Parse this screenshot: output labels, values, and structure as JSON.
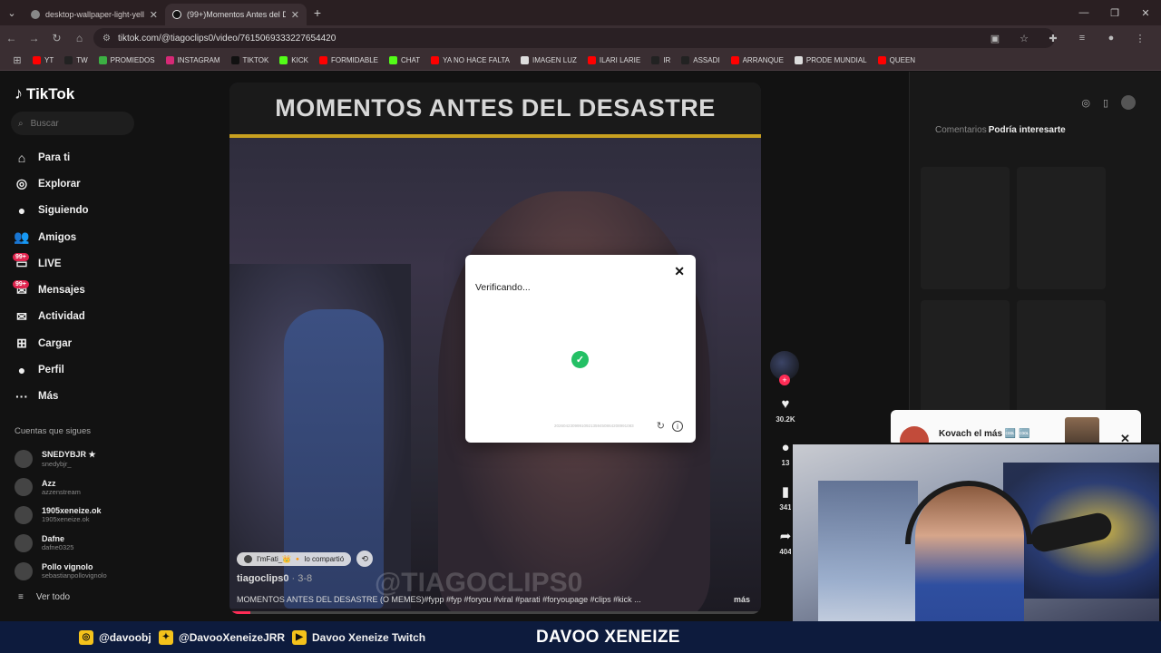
{
  "browser": {
    "tabs": [
      {
        "title": "desktop-wallpaper-light-yellow",
        "active": false
      },
      {
        "title": "(99+)Momentos Antes del Desa",
        "active": true
      }
    ],
    "url": "tiktok.com/@tiagoclips0/video/7615069333227654420",
    "bookmarks": [
      {
        "label": "YT",
        "color": "#ff0000"
      },
      {
        "label": "TW",
        "color": "#222222"
      },
      {
        "label": "PROMIEDOS",
        "color": "#3cb043"
      },
      {
        "label": "INSTAGRAM",
        "color": "#d62976"
      },
      {
        "label": "TIKTOK",
        "color": "#111111"
      },
      {
        "label": "KICK",
        "color": "#53fc18"
      },
      {
        "label": "FORMIDABLE",
        "color": "#ff0000"
      },
      {
        "label": "CHAT",
        "color": "#53fc18"
      },
      {
        "label": "YA NO HACE FALTA",
        "color": "#ff0000"
      },
      {
        "label": "IMAGEN LUZ",
        "color": "#dddddd"
      },
      {
        "label": "ILARI LARIE",
        "color": "#ff0000"
      },
      {
        "label": "IR",
        "color": "#222222"
      },
      {
        "label": "ASSADI",
        "color": "#222222"
      },
      {
        "label": "ARRANQUE",
        "color": "#ff0000"
      },
      {
        "label": "PRODE MUNDIAL",
        "color": "#dddddd"
      },
      {
        "label": "QUEEN",
        "color": "#ff0000"
      }
    ]
  },
  "tiktok": {
    "logo": "TikTok",
    "search_placeholder": "Buscar",
    "nav": [
      {
        "label": "Para ti",
        "icon": "home-icon",
        "glyph": "⌂"
      },
      {
        "label": "Explorar",
        "icon": "compass-icon",
        "glyph": "◎"
      },
      {
        "label": "Siguiendo",
        "icon": "following-icon",
        "glyph": "●"
      },
      {
        "label": "Amigos",
        "icon": "friends-icon",
        "glyph": "👥"
      },
      {
        "label": "LIVE",
        "icon": "live-icon",
        "glyph": "▭"
      },
      {
        "label": "Mensajes",
        "icon": "messages-icon",
        "glyph": "✉",
        "badge": "99+"
      },
      {
        "label": "Actividad",
        "icon": "activity-icon",
        "glyph": "✉",
        "badge": "99+"
      },
      {
        "label": "Cargar",
        "icon": "upload-icon",
        "glyph": "⊞"
      },
      {
        "label": "Perfil",
        "icon": "profile-icon",
        "glyph": "●"
      },
      {
        "label": "Más",
        "icon": "more-icon",
        "glyph": "···"
      }
    ],
    "following_title": "Cuentas que sigues",
    "following": [
      {
        "name": "SNEDYBJR ★",
        "handle": "snedybjr_"
      },
      {
        "name": "Azz",
        "handle": "azzenstream"
      },
      {
        "name": "1905xeneize.ok",
        "handle": "1905xeneize.ok"
      },
      {
        "name": "Dafne",
        "handle": "dafne0325"
      },
      {
        "name": "Pollo vignolo",
        "handle": "sebastianpollovignolo"
      }
    ],
    "see_all": "Ver todo",
    "video": {
      "banner": "MOMENTOS ANTES DEL DESASTRE",
      "watermark": "@TIAGOCLIPS0",
      "shared_by": "I'mFati_👑 🔸 lo compartió",
      "author": "tiagoclips0",
      "date": "· 3-8",
      "caption": "MOMENTOS ANTES DEL DESASTRE (O MEMES)#fypp #fyp #foryou #viral #parati #foryoupage #clips #kick ...",
      "more": "más",
      "progress": 0.04
    },
    "actions": {
      "likes": "30.2K",
      "comments": "13",
      "saves": "341",
      "shares": "404"
    },
    "right": {
      "tab_comments": "Comentarios",
      "tab_interest": "Podría interesarte"
    },
    "popup": {
      "name": "Kovach el más 🆒 🆒"
    }
  },
  "modal": {
    "title": "Verificando...",
    "code": "20260423099910921359450864208991083"
  },
  "footer": {
    "instagram": "@davoobj",
    "twitter": "@DavooXeneizeJRR",
    "youtube": "Davoo Xeneize Twitch",
    "brand": "DAVOO XENEIZE"
  }
}
